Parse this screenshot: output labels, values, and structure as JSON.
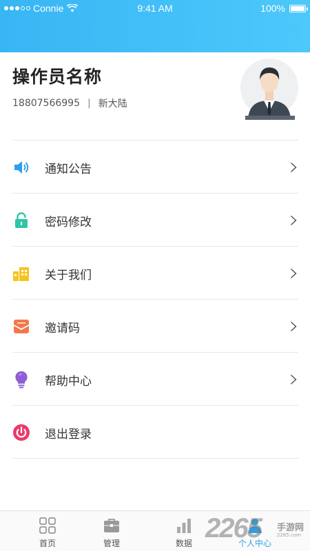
{
  "status_bar": {
    "carrier": "Connie",
    "time": "9:41 AM",
    "battery": "100%"
  },
  "profile": {
    "operator_name": "操作员名称",
    "phone": "18807566995",
    "separator": "|",
    "company": "新大陆"
  },
  "menu": {
    "items": [
      {
        "label": "通知公告",
        "icon": "speaker-icon",
        "color": "#2b9ff0"
      },
      {
        "label": "密码修改",
        "icon": "lock-icon",
        "color": "#2ec7a6"
      },
      {
        "label": "关于我们",
        "icon": "building-icon",
        "color": "#f6c41f"
      },
      {
        "label": "邀请码",
        "icon": "mail-icon",
        "color": "#f2784b"
      },
      {
        "label": "帮助中心",
        "icon": "lightbulb-icon",
        "color": "#8e5fd6"
      },
      {
        "label": "退出登录",
        "icon": "power-icon",
        "color": "#ea3a68"
      }
    ]
  },
  "tab_bar": {
    "tabs": [
      {
        "label": "首页",
        "icon": "grid-icon",
        "active": false
      },
      {
        "label": "管理",
        "icon": "briefcase-icon",
        "active": false
      },
      {
        "label": "数据",
        "icon": "bar-chart-icon",
        "active": false
      },
      {
        "label": "个人中心",
        "icon": "person-icon",
        "active": true
      }
    ]
  },
  "watermark": {
    "number": "2265",
    "text": "手游网",
    "url": "2265.com"
  },
  "colors": {
    "header_gradient_start": "#38b6f4",
    "header_gradient_end": "#4cc8fb",
    "active_tab": "#2da0e4"
  }
}
